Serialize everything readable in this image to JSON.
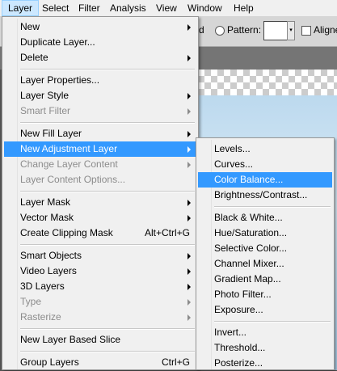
{
  "menubar": {
    "items": [
      "Layer",
      "Select",
      "Filter",
      "Analysis",
      "View",
      "Window",
      "Help"
    ]
  },
  "options": {
    "d_text": "d",
    "pattern_label": "Pattern:",
    "aligned_label": "Aligne"
  },
  "layer_menu": {
    "items": [
      {
        "label": "New",
        "shortcut": "",
        "submenu": true,
        "disabled": false
      },
      {
        "label": "Duplicate Layer...",
        "shortcut": "",
        "submenu": false,
        "disabled": false
      },
      {
        "label": "Delete",
        "shortcut": "",
        "submenu": true,
        "disabled": false
      },
      {
        "label": "Layer Properties...",
        "shortcut": "",
        "submenu": false,
        "disabled": false
      },
      {
        "label": "Layer Style",
        "shortcut": "",
        "submenu": true,
        "disabled": false
      },
      {
        "label": "Smart Filter",
        "shortcut": "",
        "submenu": true,
        "disabled": true
      },
      {
        "label": "New Fill Layer",
        "shortcut": "",
        "submenu": true,
        "disabled": false
      },
      {
        "label": "New Adjustment Layer",
        "shortcut": "",
        "submenu": true,
        "disabled": false
      },
      {
        "label": "Change Layer Content",
        "shortcut": "",
        "submenu": true,
        "disabled": true
      },
      {
        "label": "Layer Content Options...",
        "shortcut": "",
        "submenu": false,
        "disabled": true
      },
      {
        "label": "Layer Mask",
        "shortcut": "",
        "submenu": true,
        "disabled": false
      },
      {
        "label": "Vector Mask",
        "shortcut": "",
        "submenu": true,
        "disabled": false
      },
      {
        "label": "Create Clipping Mask",
        "shortcut": "Alt+Ctrl+G",
        "submenu": false,
        "disabled": false
      },
      {
        "label": "Smart Objects",
        "shortcut": "",
        "submenu": true,
        "disabled": false
      },
      {
        "label": "Video Layers",
        "shortcut": "",
        "submenu": true,
        "disabled": false
      },
      {
        "label": "3D Layers",
        "shortcut": "",
        "submenu": true,
        "disabled": false
      },
      {
        "label": "Type",
        "shortcut": "",
        "submenu": true,
        "disabled": true
      },
      {
        "label": "Rasterize",
        "shortcut": "",
        "submenu": true,
        "disabled": true
      },
      {
        "label": "New Layer Based Slice",
        "shortcut": "",
        "submenu": false,
        "disabled": false
      },
      {
        "label": "Group Layers",
        "shortcut": "Ctrl+G",
        "submenu": false,
        "disabled": false
      }
    ]
  },
  "adjustment_menu": {
    "items": [
      "Levels...",
      "Curves...",
      "Color Balance...",
      "Brightness/Contrast...",
      "Black & White...",
      "Hue/Saturation...",
      "Selective Color...",
      "Channel Mixer...",
      "Gradient Map...",
      "Photo Filter...",
      "Exposure...",
      "Invert...",
      "Threshold...",
      "Posterize..."
    ],
    "highlighted": "Color Balance..."
  },
  "colors": {
    "highlight": "#3399ff",
    "menu_bg": "#f0f0f0",
    "menubar_active": "#cce8ff"
  }
}
